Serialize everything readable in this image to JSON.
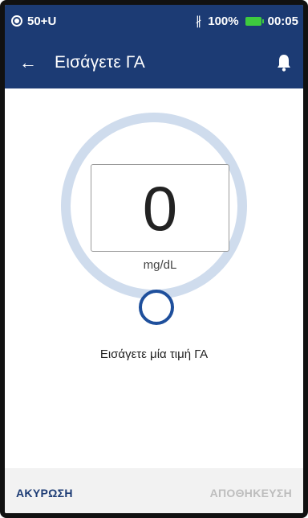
{
  "status_bar": {
    "carrier": "50+U",
    "battery_percent": "100%",
    "time": "00:05"
  },
  "app_bar": {
    "title": "Εισάγετε ΓΑ"
  },
  "entry": {
    "value": "0",
    "unit": "mg/dL",
    "hint": "Εισάγετε μία τιμή ΓΑ"
  },
  "footer": {
    "cancel_label": "ΑΚΥΡΩΣΗ",
    "save_label": "ΑΠΟΘΗΚΕΥΣΗ"
  },
  "colors": {
    "header_bg": "#1c3b74",
    "dial_ring": "#cfdced",
    "knob_border": "#1e4f9c",
    "battery": "#3ecb3e",
    "disabled_text": "#bdbdbd"
  }
}
